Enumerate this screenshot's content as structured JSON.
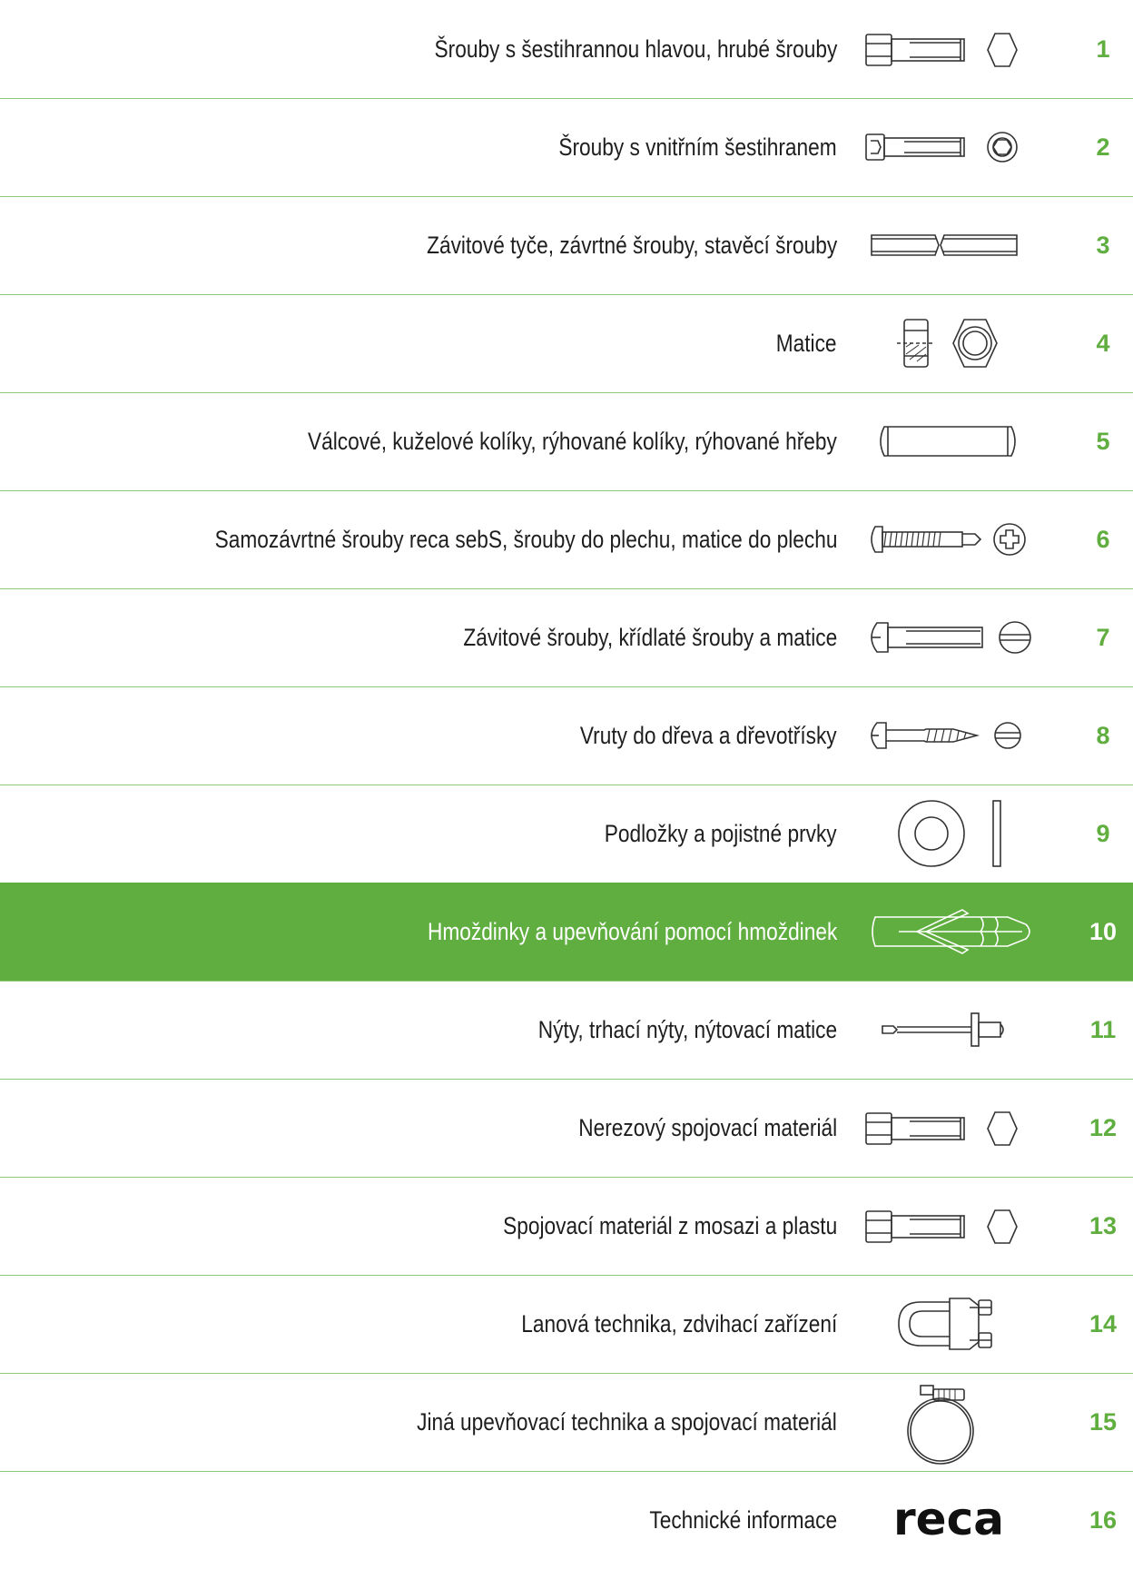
{
  "accent_color": "#5fae3f",
  "rows": [
    {
      "number": "1",
      "label": "Šrouby s šestihrannou hlavou, hrubé šrouby",
      "icon": "hex-bolt-icon"
    },
    {
      "number": "2",
      "label": "Šrouby s vnitřním šestihranem",
      "icon": "socket-cap-screw-icon"
    },
    {
      "number": "3",
      "label": "Závitové tyče, závrtné šrouby, stavěcí šrouby",
      "icon": "threaded-rod-icon"
    },
    {
      "number": "4",
      "label": "Matice",
      "icon": "hex-nut-icon"
    },
    {
      "number": "5",
      "label": "Válcové, kuželové kolíky, rýhované kolíky, rýhované hřeby",
      "icon": "dowel-pin-icon"
    },
    {
      "number": "6",
      "label": "Samozávrtné šrouby reca sebS, šrouby do plechu, matice do plechu",
      "icon": "self-drilling-screw-icon"
    },
    {
      "number": "7",
      "label": "Závitové šrouby, křídlaté šrouby a matice",
      "icon": "slotted-machine-screw-icon"
    },
    {
      "number": "8",
      "label": "Vruty do dřeva a dřevotřísky",
      "icon": "wood-screw-icon"
    },
    {
      "number": "9",
      "label": "Podložky a pojistné prvky",
      "icon": "washer-icon"
    },
    {
      "number": "10",
      "label": "Hmoždinky a upevňování pomocí hmoždinek",
      "icon": "wall-plug-icon",
      "active": true
    },
    {
      "number": "11",
      "label": "Nýty, trhací nýty, nýtovací matice",
      "icon": "blind-rivet-icon"
    },
    {
      "number": "12",
      "label": "Nerezový spojovací materiál",
      "icon": "hex-bolt-icon"
    },
    {
      "number": "13",
      "label": "Spojovací materiál z mosazi a plastu",
      "icon": "hex-bolt-icon"
    },
    {
      "number": "14",
      "label": "Lanová technika, zdvihací zařízení",
      "icon": "wire-rope-clip-icon"
    },
    {
      "number": "15",
      "label": "Jiná upevňovací technika a spojovací materiál",
      "icon": "hose-clamp-icon"
    },
    {
      "number": "16",
      "label": "Technické informace",
      "icon": "reca-logo-icon"
    }
  ],
  "logo_text": "reca"
}
